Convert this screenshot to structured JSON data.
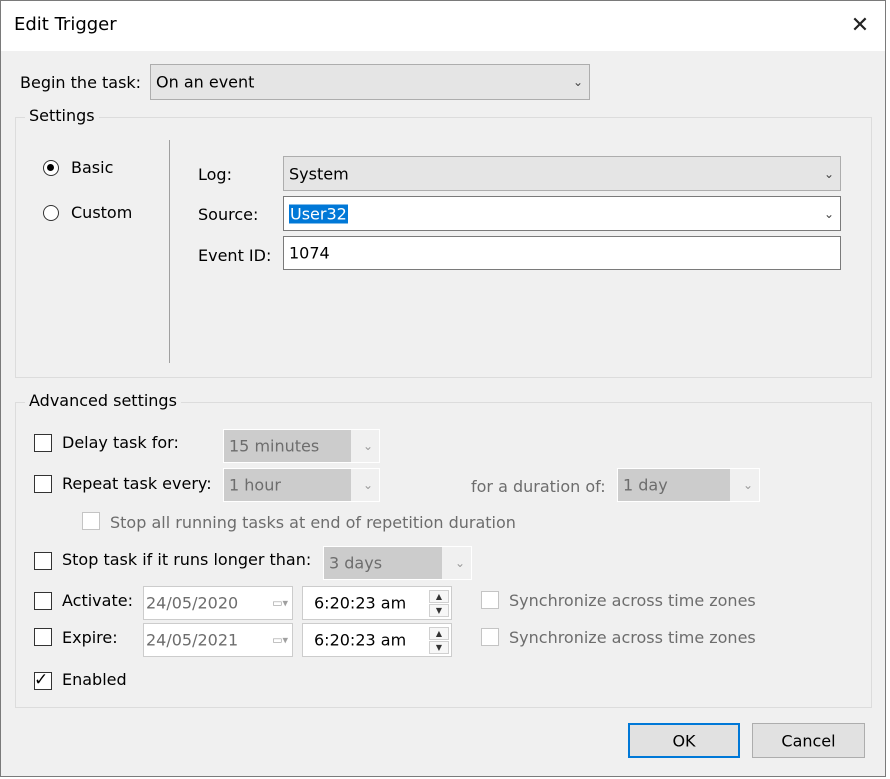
{
  "window": {
    "title": "Edit Trigger",
    "close_glyph": "✕"
  },
  "begin_task": {
    "label": "Begin the task:",
    "value": "On an event"
  },
  "settings": {
    "title": "Settings",
    "radios": [
      {
        "label": "Basic",
        "checked": true
      },
      {
        "label": "Custom",
        "checked": false
      }
    ],
    "log": {
      "label": "Log:",
      "value": "System"
    },
    "source": {
      "label": "Source:",
      "value": "User32"
    },
    "event_id": {
      "label": "Event ID:",
      "value": "1074"
    }
  },
  "advanced": {
    "title": "Advanced settings",
    "delay": {
      "label": "Delay task for:",
      "value": "15 minutes",
      "checked": false
    },
    "repeat": {
      "label": "Repeat task every:",
      "value": "1 hour",
      "checked": false,
      "duration_label": "for a duration of:",
      "duration_value": "1 day"
    },
    "stop_running": {
      "label": "Stop all running tasks at end of repetition duration",
      "checked": false
    },
    "stop_longer": {
      "label": "Stop task if it runs longer than:",
      "value": "3 days",
      "checked": false
    },
    "activate": {
      "label": "Activate:",
      "date": "24/05/2020",
      "time": "6:20:23 am",
      "sync_label": "Synchronize across time zones",
      "checked": false
    },
    "expire": {
      "label": "Expire:",
      "date": "24/05/2021",
      "time": "6:20:23 am",
      "sync_label": "Synchronize across time zones",
      "checked": false
    },
    "enabled": {
      "label": "Enabled",
      "checked": true
    }
  },
  "buttons": {
    "ok": "OK",
    "cancel": "Cancel"
  },
  "glyphs": {
    "chevron": "⌄",
    "check": "✓",
    "spin_up": "▲",
    "spin_down": "▼",
    "calendar": "▭▾"
  }
}
